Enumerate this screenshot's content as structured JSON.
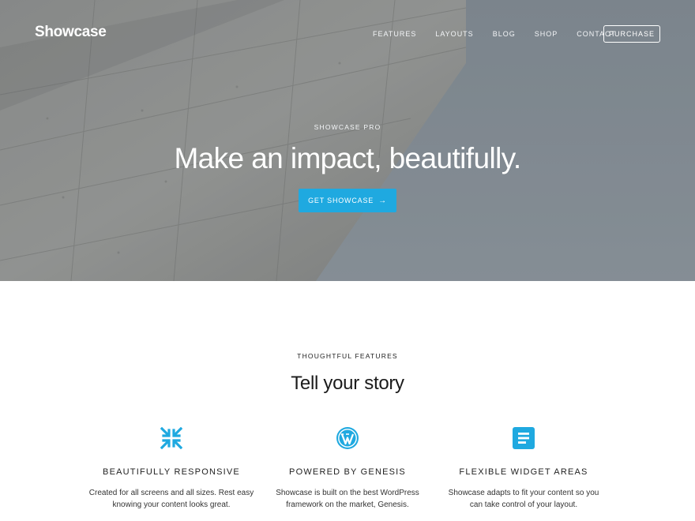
{
  "header": {
    "logo": "Showcase",
    "nav": [
      "FEATURES",
      "LAYOUTS",
      "BLOG",
      "SHOP",
      "CONTACT"
    ],
    "purchase_label": "PURCHASE"
  },
  "hero": {
    "eyebrow": "SHOWCASE PRO",
    "title": "Make an impact, beautifully.",
    "cta_label": "GET SHOWCASE",
    "cta_color": "#1fa9e0"
  },
  "features": {
    "eyebrow": "THOUGHTFUL FEATURES",
    "title": "Tell your story",
    "items": [
      {
        "icon": "compress-arrows-icon",
        "name": "BEAUTIFULLY RESPONSIVE",
        "line1": "Created for all screens and all sizes. Rest easy",
        "line2": "knowing your content looks great."
      },
      {
        "icon": "wordpress-icon",
        "name": "POWERED BY GENESIS",
        "line1": "Showcase is built on the best WordPress",
        "line2": "framework on the market, Genesis."
      },
      {
        "icon": "document-icon",
        "name": "FLEXIBLE WIDGET AREAS",
        "line1": "Showcase adapts to fit your content so you",
        "line2": "can take control of your layout."
      }
    ],
    "icon_color": "#1fa9e0"
  }
}
